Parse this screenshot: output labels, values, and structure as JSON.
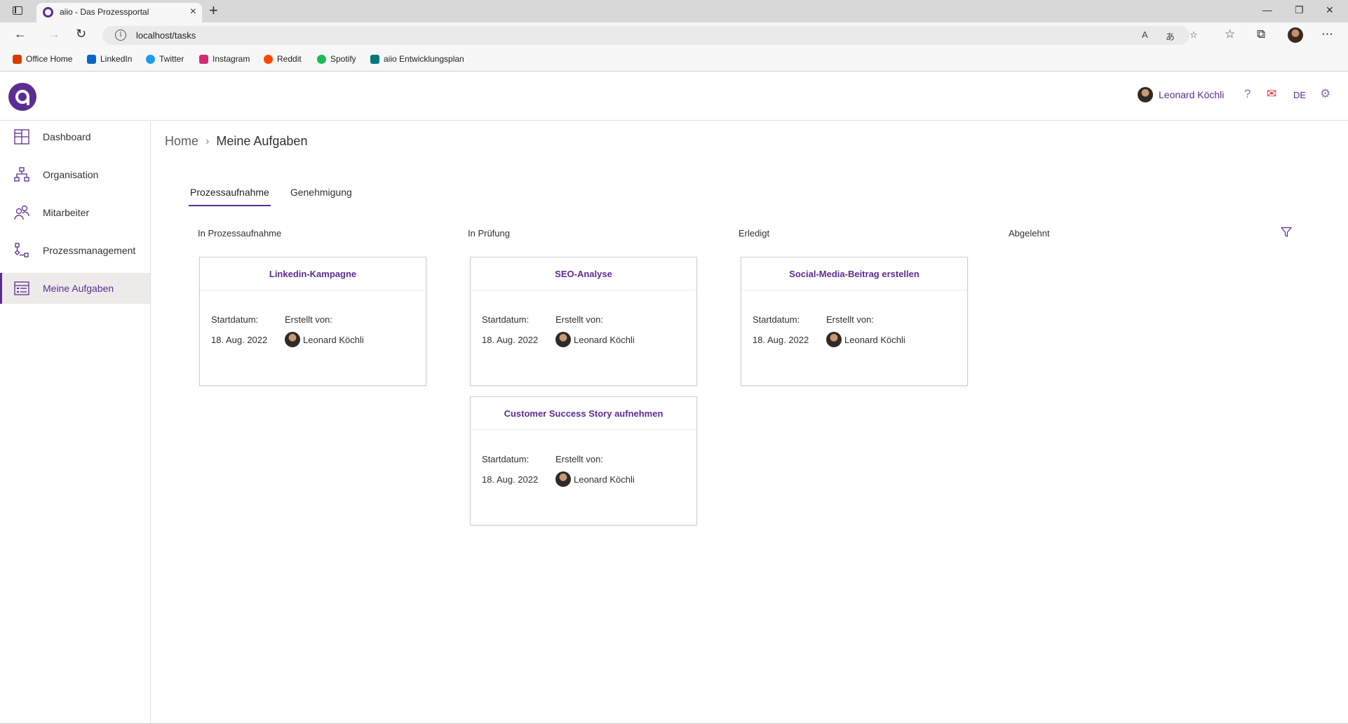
{
  "browser": {
    "tab_title": "aiio - Das Prozessportal",
    "url": "localhost/tasks",
    "bookmarks": [
      "Office Home",
      "LinkedIn",
      "Twitter",
      "Instagram",
      "Reddit",
      "Spotify",
      "aiio Entwicklungsplan"
    ]
  },
  "header": {
    "user_name": "Leonard Köchli",
    "language": "DE"
  },
  "sidebar": {
    "items": [
      {
        "label": "Dashboard"
      },
      {
        "label": "Organisation"
      },
      {
        "label": "Mitarbeiter"
      },
      {
        "label": "Prozessmanagement"
      },
      {
        "label": "Meine Aufgaben"
      }
    ]
  },
  "breadcrumb": {
    "home": "Home",
    "current": "Meine Aufgaben"
  },
  "tabs": [
    "Prozessaufnahme",
    "Genehmigung"
  ],
  "columns": [
    "In Prozessaufnahme",
    "In Prüfung",
    "Erledigt",
    "Abgelehnt"
  ],
  "cards": [
    {
      "title": "Linkedin-Kampagne",
      "start_label": "Startdatum:",
      "creator_label": "Erstellt von:",
      "date": "18. Aug. 2022",
      "creator": "Leonard Köchli"
    },
    {
      "title": "SEO-Analyse",
      "start_label": "Startdatum:",
      "creator_label": "Erstellt von:",
      "date": "18. Aug. 2022",
      "creator": "Leonard Köchli"
    },
    {
      "title": "Social-Media-Beitrag erstellen",
      "start_label": "Startdatum:",
      "creator_label": "Erstellt von:",
      "date": "18. Aug. 2022",
      "creator": "Leonard Köchli"
    },
    {
      "title": "Customer Success Story aufnehmen",
      "start_label": "Startdatum:",
      "creator_label": "Erstellt von:",
      "date": "18. Aug. 2022",
      "creator": "Leonard Köchli"
    }
  ],
  "colors": {
    "brand": "#5c2d91"
  }
}
